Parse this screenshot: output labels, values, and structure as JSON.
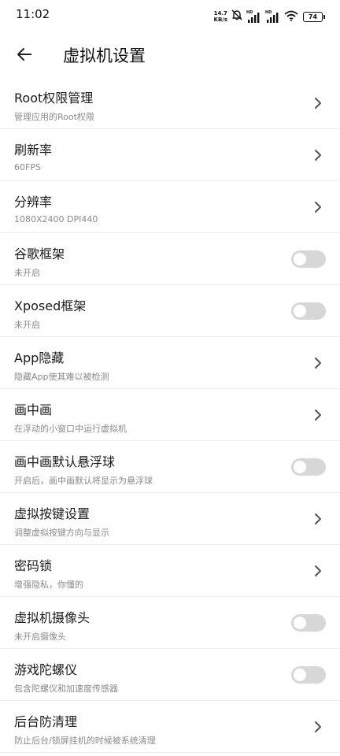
{
  "status_bar": {
    "time": "11:02",
    "net_speed_value": "14.7",
    "net_speed_unit": "KB/s",
    "sim1_label": "HD",
    "sim2_label": "HD",
    "battery": "74",
    "icons": [
      "mute-bell-icon",
      "signal-icon",
      "signal-icon",
      "wifi-icon",
      "battery-icon"
    ]
  },
  "header": {
    "title": "虚拟机设置",
    "back_icon": "back-arrow-icon"
  },
  "settings": [
    {
      "id": "root",
      "title": "Root权限管理",
      "subtitle": "管理应用的Root权限",
      "control": "chevron"
    },
    {
      "id": "refresh",
      "title": "刷新率",
      "subtitle": "60FPS",
      "control": "chevron"
    },
    {
      "id": "resolution",
      "title": "分辨率",
      "subtitle": "1080X2400 DPI440",
      "control": "chevron"
    },
    {
      "id": "google",
      "title": "谷歌框架",
      "subtitle": "未开启",
      "control": "toggle",
      "on": false
    },
    {
      "id": "xposed",
      "title": "Xposed框架",
      "subtitle": "未开启",
      "control": "toggle",
      "on": false
    },
    {
      "id": "app-hide",
      "title": "App隐藏",
      "subtitle": "隐藏App使其难以被检测",
      "control": "chevron"
    },
    {
      "id": "pip",
      "title": "画中画",
      "subtitle": "在浮动的小窗口中运行虚拟机",
      "control": "chevron"
    },
    {
      "id": "pip-float",
      "title": "画中画默认悬浮球",
      "subtitle": "开启后，画中画默认将显示为悬浮球",
      "control": "toggle",
      "on": false
    },
    {
      "id": "vkeys",
      "title": "虚拟按键设置",
      "subtitle": "调整虚拟按键方向与显示",
      "control": "chevron"
    },
    {
      "id": "lock",
      "title": "密码锁",
      "subtitle": "增强隐私，你懂的",
      "control": "chevron"
    },
    {
      "id": "camera",
      "title": "虚拟机摄像头",
      "subtitle": "未开启摄像头",
      "control": "toggle",
      "on": false
    },
    {
      "id": "gyro",
      "title": "游戏陀螺仪",
      "subtitle": "包含陀螺仪和加速度传感器",
      "control": "toggle",
      "on": false
    },
    {
      "id": "background",
      "title": "后台防清理",
      "subtitle": "防止后台/锁屏挂机的时候被系统清理",
      "control": "chevron"
    }
  ],
  "colors": {
    "toggle_off": "#d7d7d7",
    "subtitle": "#8a8a8a",
    "chevron": "#555555"
  }
}
